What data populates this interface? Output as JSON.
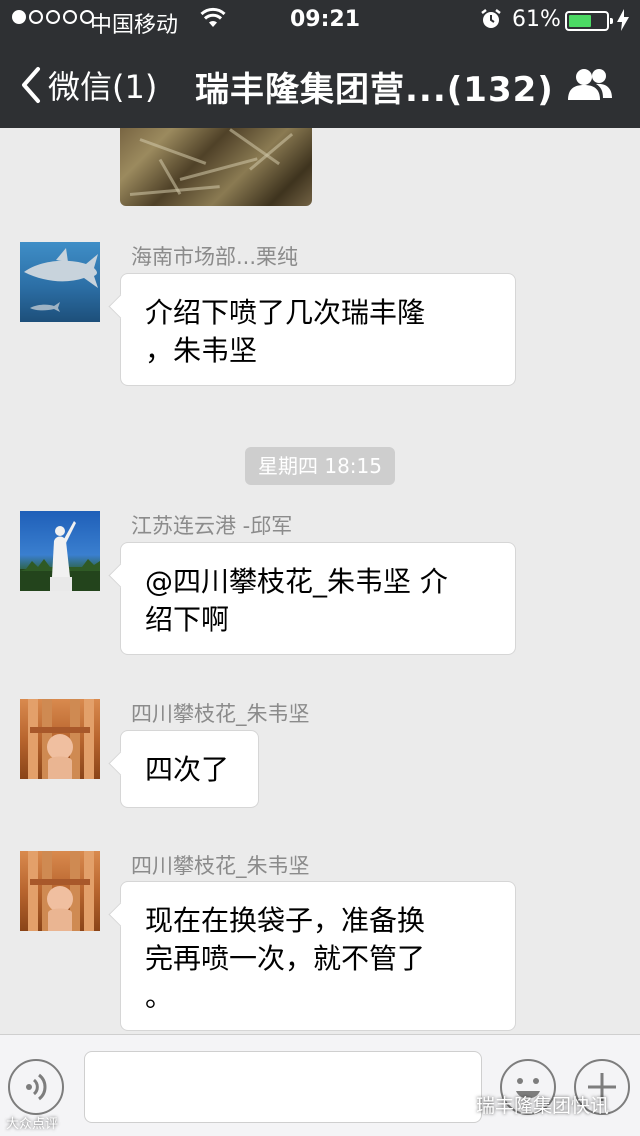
{
  "status_bar": {
    "carrier": "中国移动",
    "time": "09:21",
    "battery_percent": "61%",
    "battery_level": 0.61,
    "signal_dots_filled": 1,
    "signal_dots_total": 5
  },
  "nav": {
    "back_label": "微信(1)",
    "title": "瑞丰隆集团营...(132)",
    "group_icon": "people-icon"
  },
  "messages": [
    {
      "type": "image"
    },
    {
      "sender": "海南市场部...栗纯",
      "text": "介绍下喷了几次瑞丰隆\n，朱韦坚",
      "avatar": "shark"
    },
    {
      "type": "time",
      "text": "星期四 18:15"
    },
    {
      "sender": "江苏连云港 -邱军",
      "text": "@四川攀枝花_朱韦坚 介\n绍下啊",
      "avatar": "statue"
    },
    {
      "sender": "四川攀枝花_朱韦坚",
      "text": "四次了",
      "avatar": "child"
    },
    {
      "sender": "四川攀枝花_朱韦坚",
      "text": "现在在换袋子，准备换\n完再喷一次，就不管了\n。",
      "avatar": "child"
    }
  ],
  "input_bar": {
    "voice_icon": "voice-icon",
    "emoji_icon": "emoji-icon",
    "plus_icon": "plus-icon"
  },
  "watermark": {
    "account": "瑞丰隆集团快讯",
    "left_text": "大众点评"
  },
  "colors": {
    "bar_background": "#2e3033",
    "chat_background": "#ebebeb",
    "battery_fill": "#4cd964"
  }
}
